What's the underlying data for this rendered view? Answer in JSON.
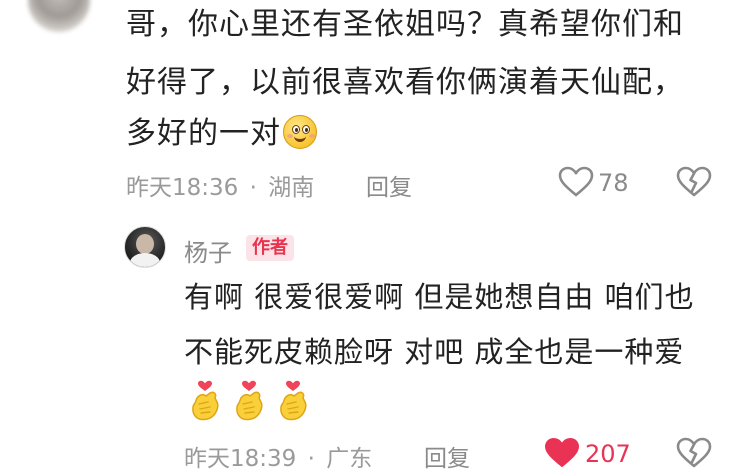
{
  "comment": {
    "lines": [
      "哥，你心里还有圣依姐吗？真希望你们和",
      "好得了，以前很喜欢看你俩演着天仙配，",
      "多好的一对"
    ],
    "emoji": "smiling-face-emoji",
    "time": "昨天18:36",
    "separator": "·",
    "location": "湖南",
    "reply_label": "回复",
    "like_count": "78",
    "liked": false
  },
  "reply": {
    "author": "杨子",
    "badge": "作者",
    "lines": [
      "有啊 很爱很爱啊 但是她想自由 咱们也",
      "不能死皮赖脸呀 对吧 成全也是一种爱"
    ],
    "emojis": [
      "heart-hands-emoji",
      "heart-hands-emoji",
      "heart-hands-emoji"
    ],
    "time": "昨天18:39",
    "separator": "·",
    "location": "广东",
    "reply_label": "回复",
    "like_count": "207",
    "liked": true
  },
  "colors": {
    "text": "#222222",
    "meta": "#9a9a9a",
    "liked_red": "#ea3354",
    "badge_bg": "#fbe3e7",
    "badge_text": "#e8344f"
  }
}
